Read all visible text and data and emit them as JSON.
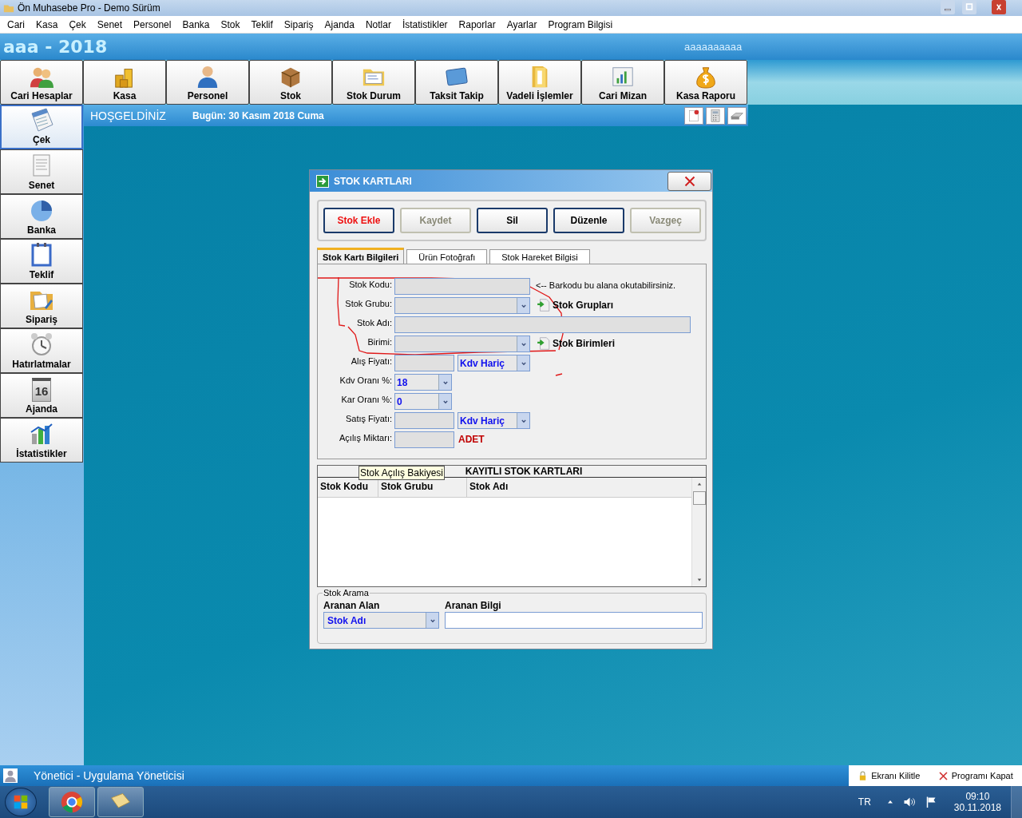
{
  "window": {
    "title": "Ön Muhasebe Pro - Demo Sürüm"
  },
  "menu": [
    "Cari",
    "Kasa",
    "Çek",
    "Senet",
    "Personel",
    "Banka",
    "Stok",
    "Teklif",
    "Sipariş",
    "Ajanda",
    "Notlar",
    "İstatistikler",
    "Raporlar",
    "Ayarlar",
    "Program Bilgisi"
  ],
  "header": {
    "title": "aaa - 2018",
    "user": "aaaaaaaaaa"
  },
  "toolbar": [
    "Cari Hesaplar",
    "Kasa",
    "Personel",
    "Stok",
    "Stok Durum",
    "Taksit Takip",
    "Vadeli İşlemler",
    "Cari Mizan",
    "Kasa Raporu"
  ],
  "sidebar": [
    {
      "label": "Çek",
      "selected": true
    },
    {
      "label": "Senet",
      "selected": false
    },
    {
      "label": "Banka",
      "selected": false
    },
    {
      "label": "Teklif",
      "selected": false
    },
    {
      "label": "Sipariş",
      "selected": false
    },
    {
      "label": "Hatırlatmalar",
      "selected": false
    },
    {
      "label": "Ajanda",
      "selected": false,
      "icon_text": "16"
    },
    {
      "label": "İstatistikler",
      "selected": false
    }
  ],
  "welcome": {
    "title": "HOŞGELDİNİZ",
    "date": "Bugün: 30 Kasım 2018 Cuma"
  },
  "dialog": {
    "title": "STOK KARTLARI",
    "buttons": [
      {
        "label": "Stok Ekle",
        "kind": "accent",
        "disabled": false
      },
      {
        "label": "Kaydet",
        "kind": "normal",
        "disabled": true
      },
      {
        "label": "Sil",
        "kind": "normal",
        "disabled": false
      },
      {
        "label": "Düzenle",
        "kind": "normal",
        "disabled": false
      },
      {
        "label": "Vazgeç",
        "kind": "normal",
        "disabled": true
      }
    ],
    "tabs": [
      {
        "label": "Stok Kartı Bilgileri",
        "selected": true
      },
      {
        "label": "Ürün Fotoğrafı",
        "selected": false
      },
      {
        "label": "Stok Hareket Bilgisi",
        "selected": false
      }
    ],
    "form": [
      {
        "label": "Stok Kodu:",
        "kind": "text",
        "note": "<-- Barkodu bu alana okutabilirsiniz."
      },
      {
        "label": "Stok Grubu:",
        "kind": "combo",
        "link": "Stok Grupları"
      },
      {
        "label": "Stok Adı:",
        "kind": "wide"
      },
      {
        "label": "Birimi:",
        "kind": "combo",
        "link": "Stok Birimleri"
      },
      {
        "label": "Alış Fiyatı:",
        "kind": "price",
        "option": "Kdv Hariç"
      },
      {
        "label": "Kdv Oranı %:",
        "kind": "rate",
        "value": "18"
      },
      {
        "label": "Kar Oranı %:",
        "kind": "rate",
        "value": "0"
      },
      {
        "label": "Satış Fiyatı:",
        "kind": "price",
        "option": "Kdv Hariç"
      },
      {
        "label": "Açılış Miktarı:",
        "kind": "qty",
        "unit": "ADET"
      }
    ],
    "grid": {
      "title": "KAYITLI STOK KARTLARI",
      "columns": [
        "Stok Kodu",
        "Stok Grubu",
        "Stok Adı"
      ]
    },
    "tooltip": "Stok Açılış Bakiyesi",
    "search": {
      "legend": "Stok Arama",
      "field_label": "Aranan Alan",
      "field_value": "Stok Adı",
      "query_label": "Aranan Bilgi"
    }
  },
  "status": {
    "user": "Yönetici - Uygulama Yöneticisi",
    "actions": [
      "Ekranı Kilitle",
      "Programı Kapat"
    ]
  },
  "taskbar": {
    "language": "TR",
    "time": "09:10",
    "date": "30.11.2018"
  }
}
